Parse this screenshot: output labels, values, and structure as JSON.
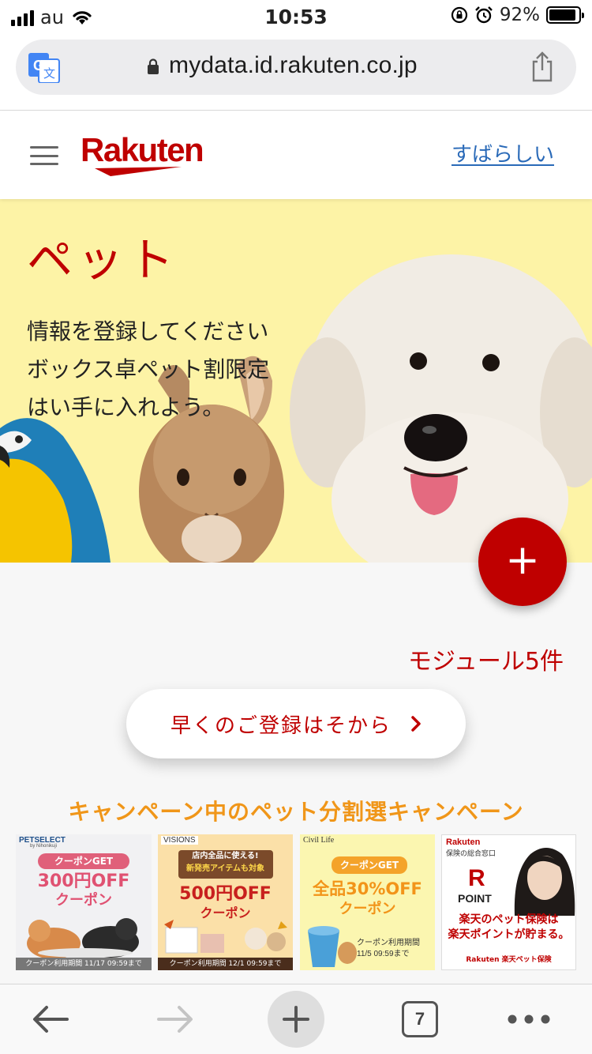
{
  "status_bar": {
    "carrier": "au",
    "time": "10:53",
    "battery_percent": "92%",
    "battery_level": 0.92,
    "icons": [
      "signal-icon",
      "wifi-icon",
      "rotation-lock-icon",
      "alarm-icon",
      "battery-icon"
    ]
  },
  "browser": {
    "url": "mydata.id.rakuten.co.jp",
    "open_tabs": "7",
    "icons": [
      "translate-icon",
      "lock-icon",
      "share-icon",
      "back-arrow-icon",
      "forward-arrow-icon",
      "new-tab-plus-icon",
      "more-dots-icon"
    ]
  },
  "header": {
    "logo": "Rakuten",
    "link": "すばらしい",
    "icons": [
      "hamburger-menu-icon"
    ]
  },
  "hero": {
    "title": "ペット",
    "description": "情報を登録してくださいボックス卓ペット割限定はい手に入れよう。"
  },
  "module": {
    "count_label": "モジュール5件",
    "fab_symbol": "+"
  },
  "register_button": {
    "label": "早くのご登録はそから"
  },
  "campaign": {
    "title": "キャンペーン中のペット分割選キャンペーン",
    "banners": [
      {
        "brand": "PETSELECT",
        "brand_sub": "by Nihonikuji",
        "badge": "クーポンGET",
        "headline": "300円OFF",
        "sub": "クーポン",
        "footer": "クーポン利用期間 11/17 09:59まで"
      },
      {
        "brand": "VISIONS",
        "badge_line1": "店内全品に使える!",
        "badge_line2": "新発売アイテムも対象",
        "headline": "500円OFF",
        "sub": "クーポン",
        "footer": "クーポン利用期間 12/1 09:59まで"
      },
      {
        "brand": "Civil Life",
        "badge": "クーポンGET",
        "headline": "全品30%OFF",
        "sub": "クーポン",
        "footer_line1": "クーポン利用期間",
        "footer_line2": "11/5 09:59まで"
      },
      {
        "brand": "Rakuten",
        "brand_sub": "保険の総合窓口",
        "point_label": "POINT",
        "headline_line1": "楽天のペット保険は",
        "headline_line2": "楽天ポイントが貯まる。",
        "footer": "Rakuten 楽天ペット保険"
      }
    ]
  },
  "colors": {
    "brand_red": "#bf0000",
    "hero_background": "#fdf3a6",
    "campaign_orange": "#f09619",
    "link_blue": "#2a6ab8"
  }
}
